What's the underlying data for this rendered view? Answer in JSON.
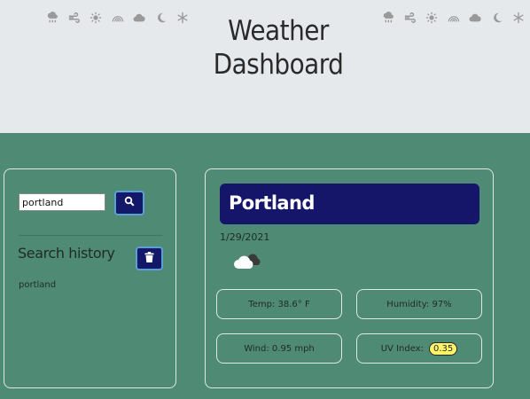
{
  "header": {
    "title_line1": "Weather",
    "title_line2": "Dashboard",
    "bg_color": "#e6e9ec",
    "icons": [
      "rain-cloud-icon",
      "wind-icon",
      "sun-icon",
      "rainbow-icon",
      "cloud-icon",
      "moon-icon",
      "snowflake-icon"
    ]
  },
  "search": {
    "input_value": "portland",
    "button_icon": "search-icon",
    "history_heading": "Search history",
    "clear_icon": "trash-icon",
    "history": [
      "portland"
    ]
  },
  "weather": {
    "city": "Portland",
    "date": "1/29/2021",
    "condition_icon": "partly-cloudy-icon",
    "temp": "Temp: 38.6° F",
    "humidity": "Humidity: 97%",
    "wind": "Wind: 0.95 mph",
    "uv_label": "UV Index:",
    "uv_value": "0.35"
  },
  "colors": {
    "page_bg": "#4f8a74",
    "accent": "#15166a",
    "uv_badge": "#fff36a"
  }
}
